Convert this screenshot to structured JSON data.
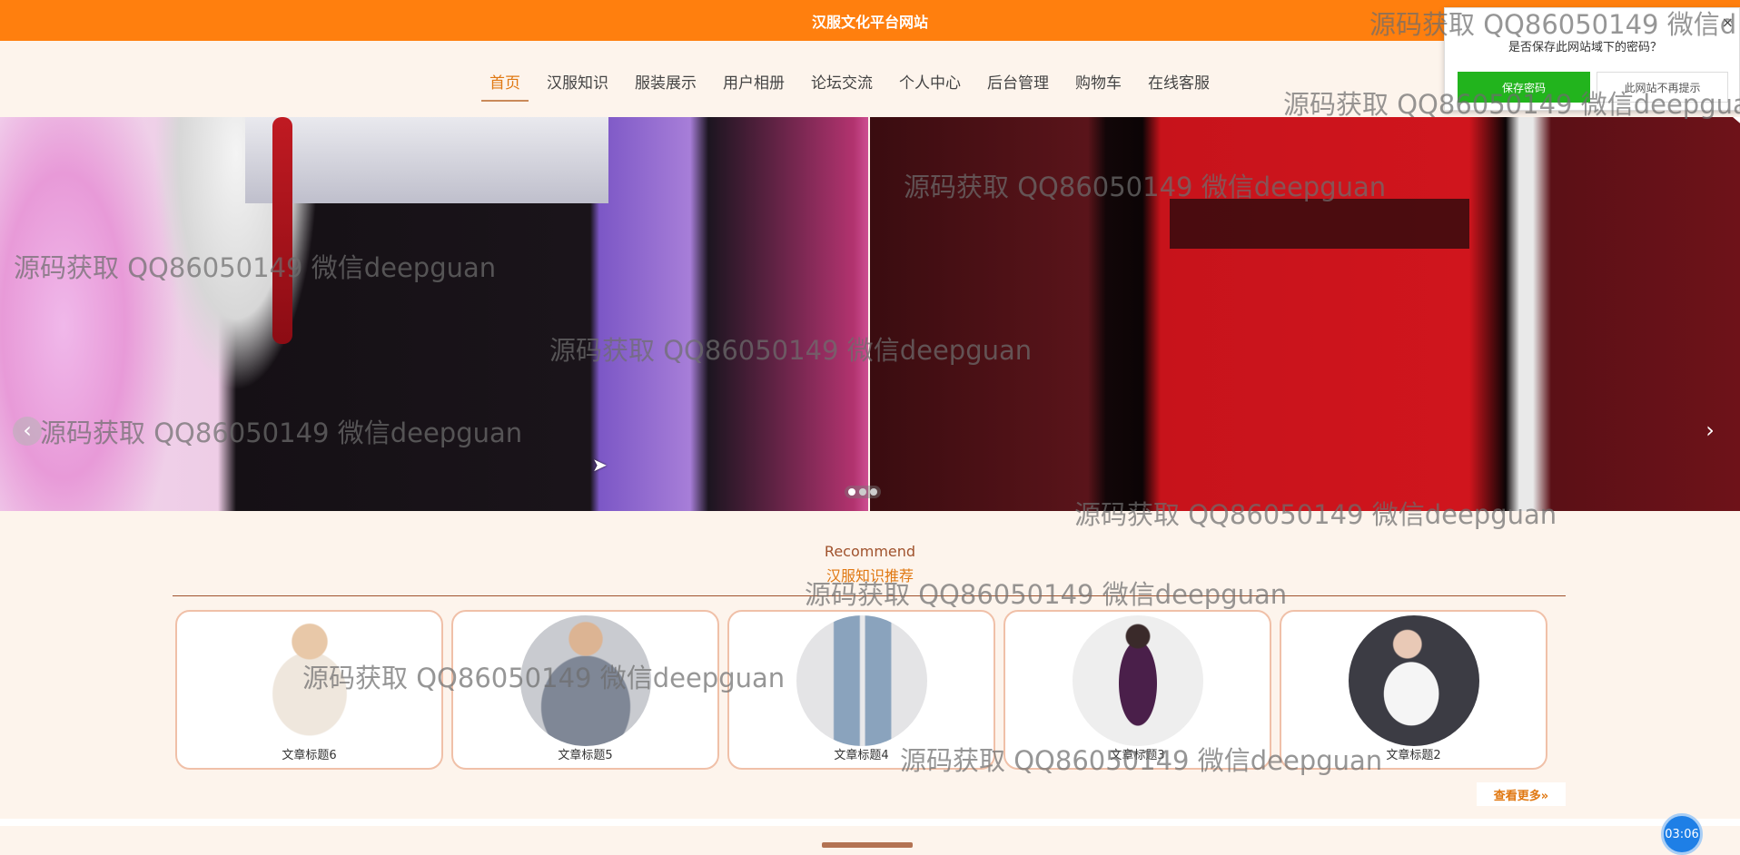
{
  "header": {
    "site_title": "汉服文化平台网站"
  },
  "nav": {
    "items": [
      {
        "label": "首页",
        "active": true
      },
      {
        "label": "汉服知识"
      },
      {
        "label": "服装展示"
      },
      {
        "label": "用户相册"
      },
      {
        "label": "论坛交流"
      },
      {
        "label": "个人中心"
      },
      {
        "label": "后台管理"
      },
      {
        "label": "购物车"
      },
      {
        "label": "在线客服"
      }
    ]
  },
  "carousel": {
    "prev_icon": "‹",
    "next_icon": "›",
    "dots": 3,
    "active_dot": 0
  },
  "recommend": {
    "title_en": "Recommend",
    "title_cn": "汉服知识推荐",
    "cards": [
      {
        "title": "文章标题6",
        "image": "man-white-jacket-photo"
      },
      {
        "title": "文章标题5",
        "image": "man-grey-blazer-photo"
      },
      {
        "title": "文章标题4",
        "image": "jeans-photo"
      },
      {
        "title": "文章标题3",
        "image": "woman-purple-dress-photo"
      },
      {
        "title": "文章标题2",
        "image": "woman-white-tshirt-photo"
      }
    ],
    "more_label": "查看更多»"
  },
  "password_prompt": {
    "question": "是否保存此网站域下的密码？",
    "save_label": "保存密码",
    "never_label": "此网站不再提示",
    "close_icon": "×"
  },
  "timer": {
    "label": "03:06"
  },
  "watermark": {
    "text": "源码获取 QQ86050149 微信deepguan",
    "text_cut": "源码获取 QQ86050149 微信d"
  }
}
